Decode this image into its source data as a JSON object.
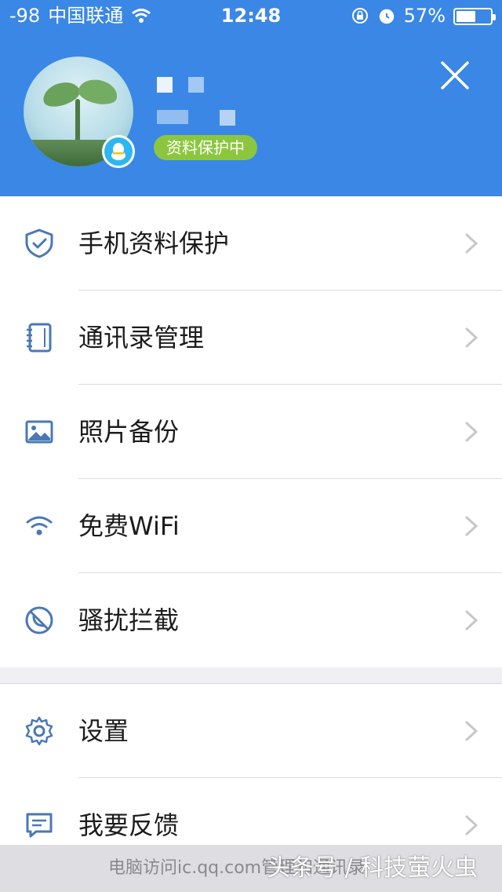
{
  "status_bar": {
    "signal": "-98",
    "carrier": "中国联通",
    "time": "12:48",
    "battery_percent": "57%",
    "battery_level": 0.57
  },
  "profile": {
    "avatar_icon": "plant-sprout-avatar",
    "badge_icon": "qq-penguin-icon",
    "protection_label": "资料保护中"
  },
  "menu_primary": [
    {
      "label": "手机资料保护",
      "icon": "shield-check-icon"
    },
    {
      "label": "通讯录管理",
      "icon": "contacts-book-icon"
    },
    {
      "label": "照片备份",
      "icon": "photo-icon"
    },
    {
      "label": "免费WiFi",
      "icon": "wifi-icon"
    },
    {
      "label": "骚扰拦截",
      "icon": "block-call-icon"
    }
  ],
  "menu_secondary": [
    {
      "label": "设置",
      "icon": "gear-icon"
    },
    {
      "label": "我要反馈",
      "icon": "feedback-icon"
    }
  ],
  "footer": {
    "left_text": "电脑访问ic.qq.com管理和通讯录",
    "watermark": "头条号 / 科技萤火虫"
  },
  "colors": {
    "header_blue": "#3a87e6",
    "icon_blue": "#4a78b5",
    "badge_green": "#8cc63f",
    "qq_blue": "#2eb6f0"
  }
}
